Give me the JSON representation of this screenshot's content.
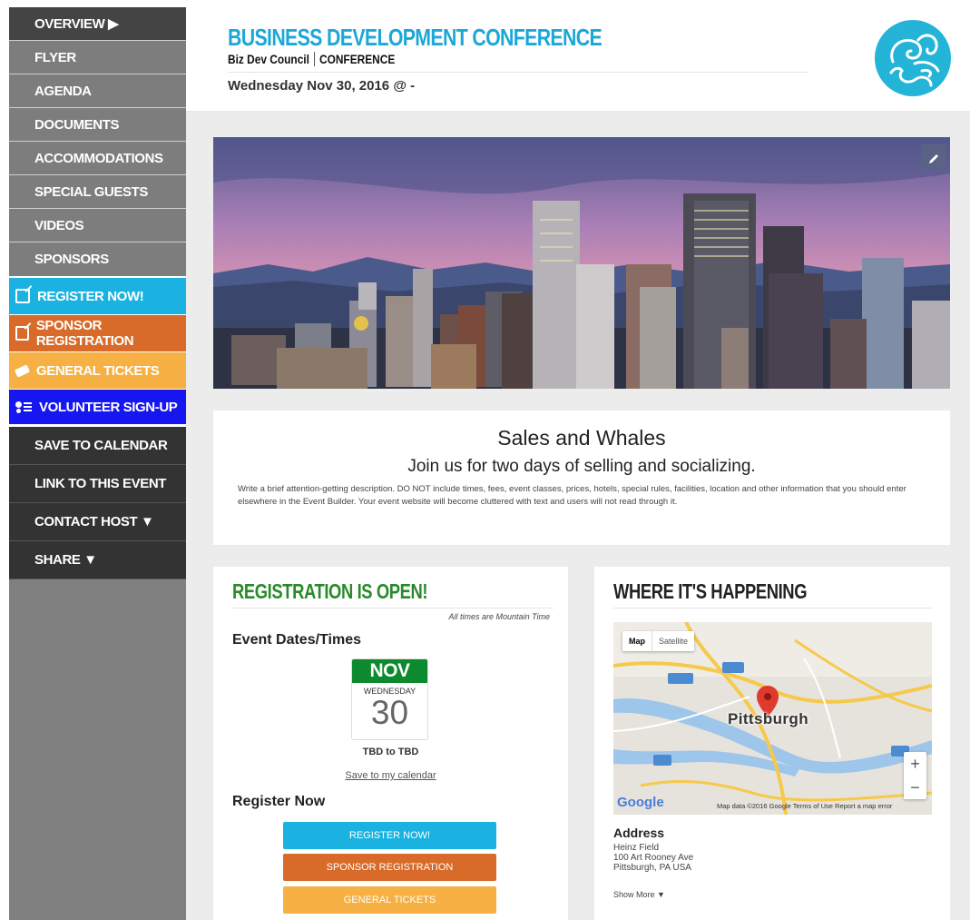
{
  "sidebar": {
    "items": [
      {
        "label": "OVERVIEW ▶"
      },
      {
        "label": "FLYER"
      },
      {
        "label": "AGENDA"
      },
      {
        "label": "DOCUMENTS"
      },
      {
        "label": "ACCOMMODATIONS"
      },
      {
        "label": "SPECIAL GUESTS"
      },
      {
        "label": "VIDEOS"
      },
      {
        "label": "SPONSORS"
      }
    ],
    "cta": [
      {
        "label": "REGISTER NOW!",
        "color": "#1ab2e0",
        "icon": "edit-icon"
      },
      {
        "label": "SPONSOR REGISTRATION",
        "color": "#d86a2a",
        "icon": "edit-icon"
      },
      {
        "label": "GENERAL TICKETS",
        "color": "#f6b043",
        "icon": "ticket-icon"
      },
      {
        "label": "VOLUNTEER SIGN-UP",
        "color": "#1616f0",
        "icon": "volunteer-icon"
      }
    ],
    "actions": [
      {
        "label": "SAVE TO CALENDAR"
      },
      {
        "label": "LINK TO THIS EVENT"
      },
      {
        "label": "CONTACT HOST ▼"
      },
      {
        "label": "SHARE ▼"
      }
    ]
  },
  "header": {
    "title": "BUSINESS DEVELOPMENT CONFERENCE",
    "org": "Biz Dev Council",
    "category": "CONFERENCE",
    "date": "Wednesday Nov 30, 2016 @ -",
    "accent_color": "#1ba8d8"
  },
  "intro": {
    "title": "Sales and Whales",
    "subtitle": "Join us for two days of selling and socializing.",
    "description": "Write a brief attention-getting description. DO NOT include times, fees, event classes, prices, hotels, special rules, facilities, location and other information that you should enter elsewhere in the Event Builder. Your event website will become cluttered with text and users will not read through it."
  },
  "registration": {
    "heading": "REGISTRATION IS OPEN!",
    "timezone_note": "All times are Mountain Time",
    "dates_heading": "Event Dates/Times",
    "calendar": {
      "month": "NOV",
      "weekday": "WEDNESDAY",
      "day": "30"
    },
    "time_range": "TBD to TBD",
    "save_link": "Save to my calendar",
    "register_heading": "Register Now",
    "buttons": [
      {
        "label": "REGISTER NOW!"
      },
      {
        "label": "SPONSOR REGISTRATION"
      },
      {
        "label": "GENERAL TICKETS"
      }
    ]
  },
  "location": {
    "heading": "WHERE IT'S HAPPENING",
    "map": {
      "tab_map": "Map",
      "tab_satellite": "Satellite",
      "city_label": "Pittsburgh",
      "google": "Google",
      "footer": "Map data ©2016 Google   Terms of Use   Report a map error",
      "zoom_in": "+",
      "zoom_out": "−"
    },
    "address_title": "Address",
    "address_lines": [
      "Heinz Field",
      "100 Art Rooney Ave",
      "Pittsburgh, PA  USA"
    ],
    "show_more": "Show More ▼"
  }
}
